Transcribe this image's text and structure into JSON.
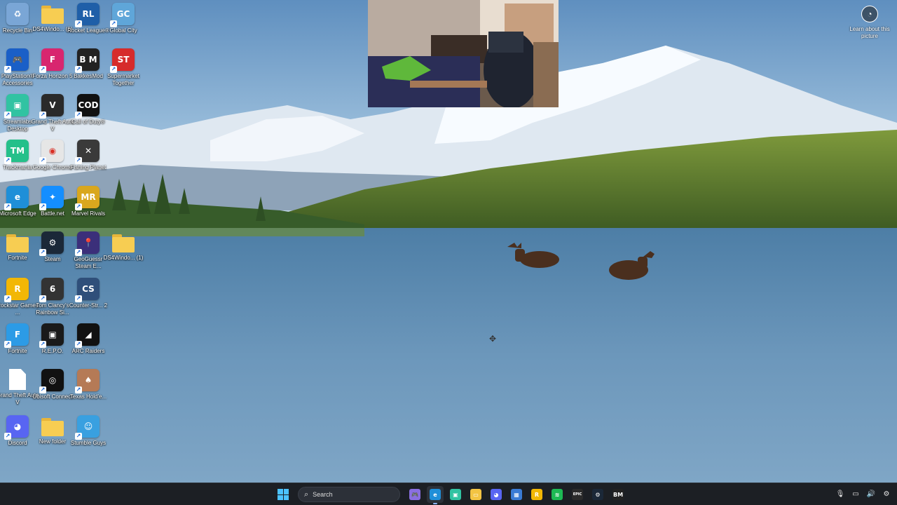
{
  "desktop": {
    "icons": [
      {
        "label": "Recycle Bin",
        "icon": "recycle-bin-icon",
        "color": "#7aa6d6",
        "glyph": "♻",
        "shortcut": false
      },
      {
        "label": "DS4Windo... (1)",
        "icon": "folder-icon",
        "color": "#f7cd52",
        "glyph": "",
        "shortcut": false
      },
      {
        "label": "Rocket League®",
        "icon": "rocket-league-icon",
        "color": "#1f5fa8",
        "glyph": "RL",
        "shortcut": true
      },
      {
        "label": "Global City",
        "icon": "global-city-icon",
        "color": "#5fa6d9",
        "glyph": "GC",
        "shortcut": true
      },
      {
        "label": "PlayStation® Accessories",
        "icon": "playstation-accessories-icon",
        "color": "#1a5fc7",
        "glyph": "🎮",
        "shortcut": true
      },
      {
        "label": "Forza Horizon 5",
        "icon": "forza-horizon-icon",
        "color": "#d8266f",
        "glyph": "F",
        "shortcut": true
      },
      {
        "label": "BakkesMod",
        "icon": "bakkesmod-icon",
        "color": "#222222",
        "glyph": "B M",
        "shortcut": true
      },
      {
        "label": "Supermarket Together",
        "icon": "supermarket-together-icon",
        "color": "#d62b2b",
        "glyph": "ST",
        "shortcut": true
      },
      {
        "label": "Streamlabs Desktop",
        "icon": "streamlabs-icon",
        "color": "#31c3a2",
        "glyph": "▣",
        "shortcut": true
      },
      {
        "label": "Grand Theft Auto V",
        "icon": "gta-v-icon",
        "color": "#2a2a2a",
        "glyph": "V",
        "shortcut": true
      },
      {
        "label": "Call of Duty®",
        "icon": "call-of-duty-icon",
        "color": "#111111",
        "glyph": "COD",
        "shortcut": true
      },
      {
        "label": "Trackmania",
        "icon": "trackmania-icon",
        "color": "#25c08a",
        "glyph": "TM",
        "shortcut": true
      },
      {
        "label": "Google Chrome",
        "icon": "chrome-icon",
        "color": "#e6e6e6",
        "glyph": "◉",
        "shortcut": true
      },
      {
        "label": "Fishing Planet",
        "icon": "fishing-planet-icon",
        "color": "#3a3a3a",
        "glyph": "✕",
        "shortcut": true
      },
      {
        "label": "Microsoft Edge",
        "icon": "edge-icon",
        "color": "#1f8fd8",
        "glyph": "e",
        "shortcut": true
      },
      {
        "label": "Battle.net",
        "icon": "battlenet-icon",
        "color": "#148eff",
        "glyph": "✦",
        "shortcut": true
      },
      {
        "label": "Marvel Rivals",
        "icon": "marvel-rivals-icon",
        "color": "#d9a71e",
        "glyph": "MR",
        "shortcut": true
      },
      {
        "label": "Fortnite",
        "icon": "folder-icon",
        "color": "#f7cd52",
        "glyph": "",
        "shortcut": false
      },
      {
        "label": "Steam",
        "icon": "steam-icon",
        "color": "#1b2838",
        "glyph": "⚙",
        "shortcut": true
      },
      {
        "label": "GeoGuessr Steam E...",
        "icon": "geoguessr-icon",
        "color": "#3b2f7a",
        "glyph": "📍",
        "shortcut": true
      },
      {
        "label": "DS4Windo... (1)",
        "icon": "zip-folder-icon",
        "color": "#f7cd52",
        "glyph": "",
        "shortcut": false
      },
      {
        "label": "Rockstar Games ...",
        "icon": "rockstar-games-icon",
        "color": "#f2b705",
        "glyph": "R",
        "shortcut": true
      },
      {
        "label": "Tom Clancy's Rainbow Si...",
        "icon": "rainbow-six-icon",
        "color": "#333333",
        "glyph": "6",
        "shortcut": true
      },
      {
        "label": "Counter-Str... 2",
        "icon": "counter-strike-icon",
        "color": "#2f4f7a",
        "glyph": "CS",
        "shortcut": true
      },
      {
        "label": "Fortnite",
        "icon": "fortnite-icon",
        "color": "#2c9be6",
        "glyph": "F",
        "shortcut": true
      },
      {
        "label": "R.E.P.O.",
        "icon": "repo-icon",
        "color": "#1a1a1a",
        "glyph": "▣",
        "shortcut": true
      },
      {
        "label": "ARC Raiders",
        "icon": "arc-raiders-icon",
        "color": "#111111",
        "glyph": "◢",
        "shortcut": true
      },
      {
        "label": "Grand Theft Auto V",
        "icon": "document-icon",
        "color": "#ffffff",
        "glyph": "",
        "shortcut": false
      },
      {
        "label": "Ubisoft Connect",
        "icon": "ubisoft-connect-icon",
        "color": "#111111",
        "glyph": "◎",
        "shortcut": true
      },
      {
        "label": "Texas Hold'e...",
        "icon": "texas-holdem-icon",
        "color": "#b57a56",
        "glyph": "♠",
        "shortcut": true
      },
      {
        "label": "Discord",
        "icon": "discord-icon",
        "color": "#5865f2",
        "glyph": "◕",
        "shortcut": true
      },
      {
        "label": "New folder",
        "icon": "folder-icon",
        "color": "#f7cd52",
        "glyph": "",
        "shortcut": false
      },
      {
        "label": "Stumble Guys",
        "icon": "stumble-guys-icon",
        "color": "#39a0e0",
        "glyph": "☺",
        "shortcut": true
      }
    ]
  },
  "learn_picture": {
    "label": "Learn about this picture",
    "icon": "camera-icon"
  },
  "taskbar": {
    "search_placeholder": "Search",
    "apps": [
      {
        "name": "gamepad-app-icon",
        "color": "#8a6fe0",
        "glyph": "🎮",
        "active": false
      },
      {
        "name": "edge-app-icon",
        "color": "#1f8fd8",
        "glyph": "e",
        "active": true
      },
      {
        "name": "streamlabs-app-icon",
        "color": "#31c3a2",
        "glyph": "▣",
        "active": false
      },
      {
        "name": "file-explorer-app-icon",
        "color": "#f3c443",
        "glyph": "▭",
        "active": false
      },
      {
        "name": "discord-app-icon",
        "color": "#5865f2",
        "glyph": "◕",
        "active": false
      },
      {
        "name": "microsoft-store-app-icon",
        "color": "#3a7bd5",
        "glyph": "▦",
        "active": false
      },
      {
        "name": "rockstar-app-icon",
        "color": "#f2b705",
        "glyph": "R",
        "active": false
      },
      {
        "name": "spotify-app-icon",
        "color": "#1db954",
        "glyph": "≋",
        "active": false
      },
      {
        "name": "epic-games-app-icon",
        "color": "#2b2b2b",
        "glyph": "EPIC",
        "active": false
      },
      {
        "name": "steam-app-icon",
        "color": "#1b2838",
        "glyph": "⚙",
        "active": false
      },
      {
        "name": "bakkesmod-app-icon",
        "color": "#222222",
        "glyph": "BM",
        "active": false
      }
    ],
    "tray": [
      {
        "name": "microphone-icon",
        "glyph": "🎙"
      },
      {
        "name": "network-icon",
        "glyph": "▭"
      },
      {
        "name": "volume-icon",
        "glyph": "🔊"
      },
      {
        "name": "notifications-icon",
        "glyph": "⚙"
      }
    ]
  }
}
